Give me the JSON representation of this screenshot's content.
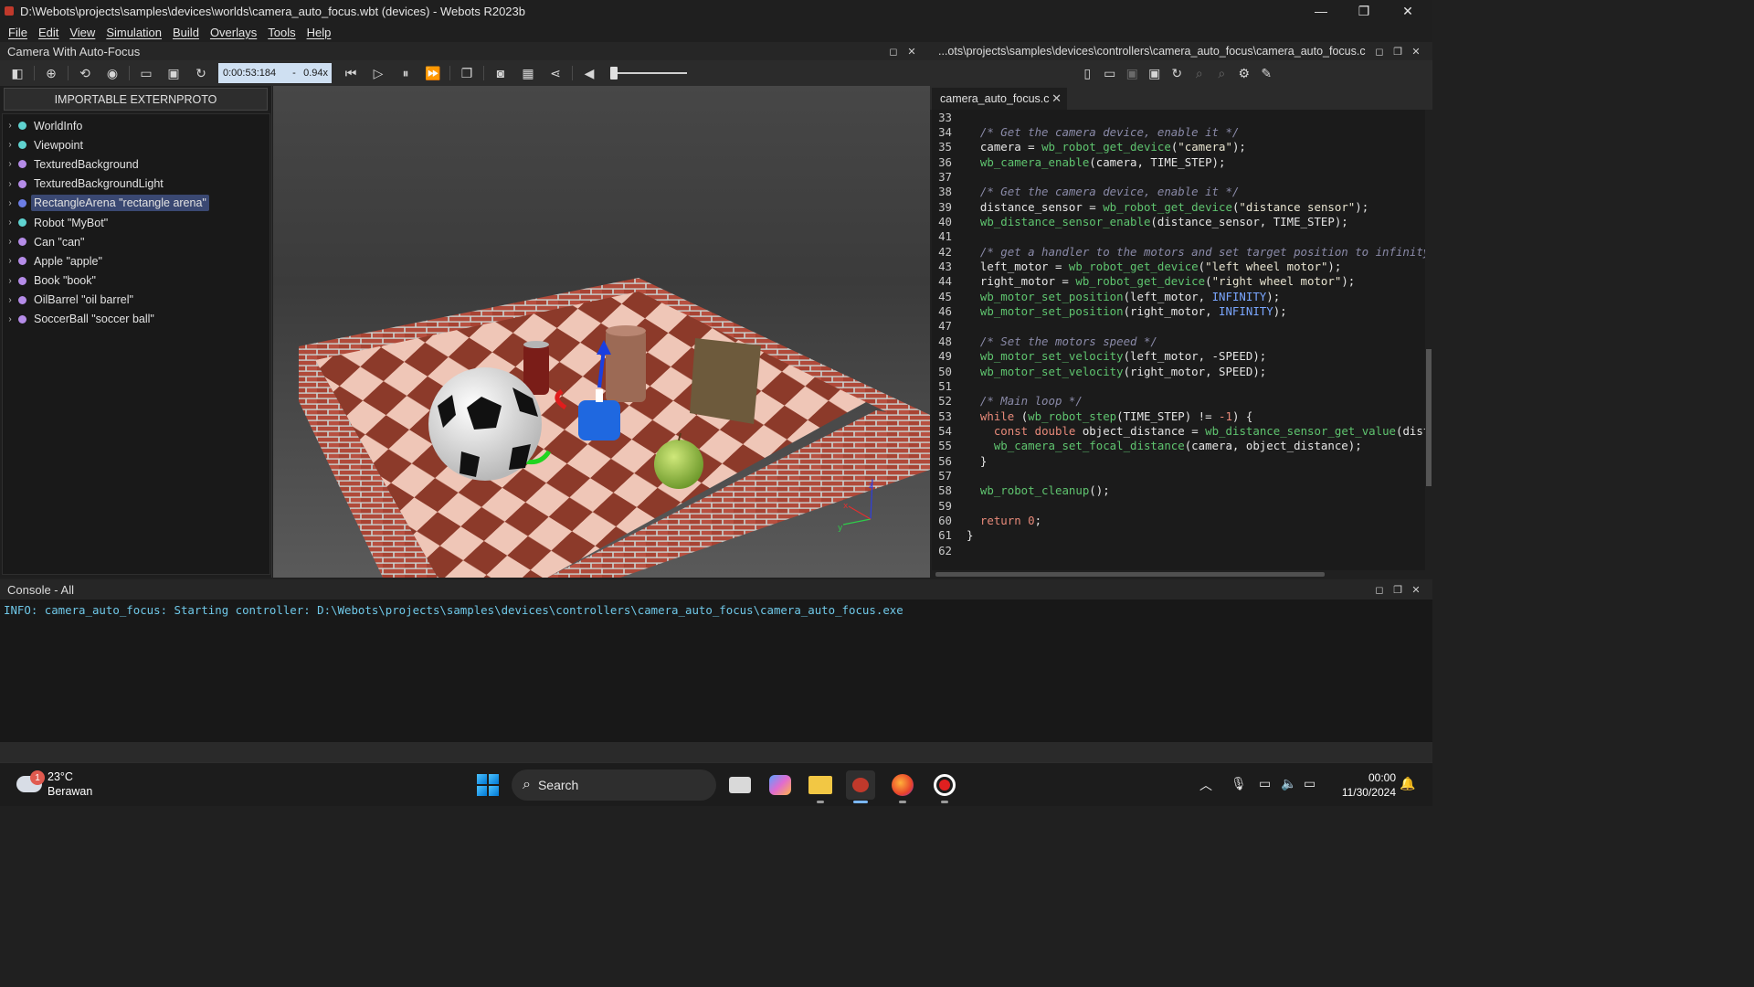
{
  "window": {
    "title": "D:\\Webots\\projects\\samples\\devices\\worlds\\camera_auto_focus.wbt (devices) - Webots R2023b",
    "minimize": "—",
    "restore": "❐",
    "close": "✕"
  },
  "menu": [
    "File",
    "Edit",
    "View",
    "Simulation",
    "Build",
    "Overlays",
    "Tools",
    "Help"
  ],
  "scene": {
    "title": "Camera With Auto-Focus",
    "time": "0:00:53:184",
    "time_sep": "-",
    "speed": "0.94x",
    "proto_button": "IMPORTABLE EXTERNPROTO",
    "tree": [
      {
        "label": "WorldInfo",
        "color": "teal"
      },
      {
        "label": "Viewpoint",
        "color": "teal"
      },
      {
        "label": "TexturedBackground",
        "color": "purple"
      },
      {
        "label": "TexturedBackgroundLight",
        "color": "purple"
      },
      {
        "label": "RectangleArena \"rectangle arena\"",
        "color": "blue",
        "selected": true
      },
      {
        "label": "Robot \"MyBot\"",
        "color": "teal"
      },
      {
        "label": "Can \"can\"",
        "color": "purple"
      },
      {
        "label": "Apple \"apple\"",
        "color": "purple"
      },
      {
        "label": "Book \"book\"",
        "color": "purple"
      },
      {
        "label": "OilBarrel \"oil barrel\"",
        "color": "purple"
      },
      {
        "label": "SoccerBall \"soccer ball\"",
        "color": "purple"
      }
    ],
    "axes": {
      "x": "x",
      "y": "y",
      "z": "z"
    }
  },
  "editor": {
    "path": "...ots\\projects\\samples\\devices\\controllers\\camera_auto_focus\\camera_auto_focus.c",
    "tab": "camera_auto_focus.c",
    "tab_close": "✕",
    "lines": [
      {
        "n": "33",
        "t": ""
      },
      {
        "n": "34",
        "t": "  /* Get the camera device, enable it */"
      },
      {
        "n": "35",
        "t": "  camera = wb_robot_get_device(\"camera\");"
      },
      {
        "n": "36",
        "t": "  wb_camera_enable(camera, TIME_STEP);"
      },
      {
        "n": "37",
        "t": ""
      },
      {
        "n": "38",
        "t": "  /* Get the camera device, enable it */"
      },
      {
        "n": "39",
        "t": "  distance_sensor = wb_robot_get_device(\"distance sensor\");"
      },
      {
        "n": "40",
        "t": "  wb_distance_sensor_enable(distance_sensor, TIME_STEP);"
      },
      {
        "n": "41",
        "t": ""
      },
      {
        "n": "42",
        "t": "  /* get a handler to the motors and set target position to infinity (speed control). */"
      },
      {
        "n": "43",
        "t": "  left_motor = wb_robot_get_device(\"left wheel motor\");"
      },
      {
        "n": "44",
        "t": "  right_motor = wb_robot_get_device(\"right wheel motor\");"
      },
      {
        "n": "45",
        "t": "  wb_motor_set_position(left_motor, INFINITY);"
      },
      {
        "n": "46",
        "t": "  wb_motor_set_position(right_motor, INFINITY);"
      },
      {
        "n": "47",
        "t": ""
      },
      {
        "n": "48",
        "t": "  /* Set the motors speed */"
      },
      {
        "n": "49",
        "t": "  wb_motor_set_velocity(left_motor, -SPEED);"
      },
      {
        "n": "50",
        "t": "  wb_motor_set_velocity(right_motor, SPEED);"
      },
      {
        "n": "51",
        "t": ""
      },
      {
        "n": "52",
        "t": "  /* Main loop */"
      },
      {
        "n": "53",
        "t": "  while (wb_robot_step(TIME_STEP) != -1) {"
      },
      {
        "n": "54",
        "t": "    const double object_distance = wb_distance_sensor_get_value(distance_sensor);"
      },
      {
        "n": "55",
        "t": "    wb_camera_set_focal_distance(camera, object_distance);"
      },
      {
        "n": "56",
        "t": "  }"
      },
      {
        "n": "57",
        "t": ""
      },
      {
        "n": "58",
        "t": "  wb_robot_cleanup();"
      },
      {
        "n": "59",
        "t": ""
      },
      {
        "n": "60",
        "t": "  return 0;"
      },
      {
        "n": "61",
        "t": "}"
      },
      {
        "n": "62",
        "t": ""
      }
    ]
  },
  "console": {
    "title": "Console - All",
    "lines": [
      "INFO: camera_auto_focus: Starting controller: D:\\Webots\\projects\\samples\\devices\\controllers\\camera_auto_focus\\camera_auto_focus.exe"
    ]
  },
  "taskbar": {
    "weather_badge": "1",
    "temperature": "23°C",
    "condition": "Berawan",
    "search_label": "Search",
    "time": "00:00",
    "date": "11/30/2024"
  },
  "colors": {
    "accent": "#3a4872",
    "console_text": "#6fc8e8",
    "comment": "#8a8aa8",
    "keyword": "#e88a7a",
    "function": "#5fc46f",
    "constant": "#7aa6ff"
  }
}
